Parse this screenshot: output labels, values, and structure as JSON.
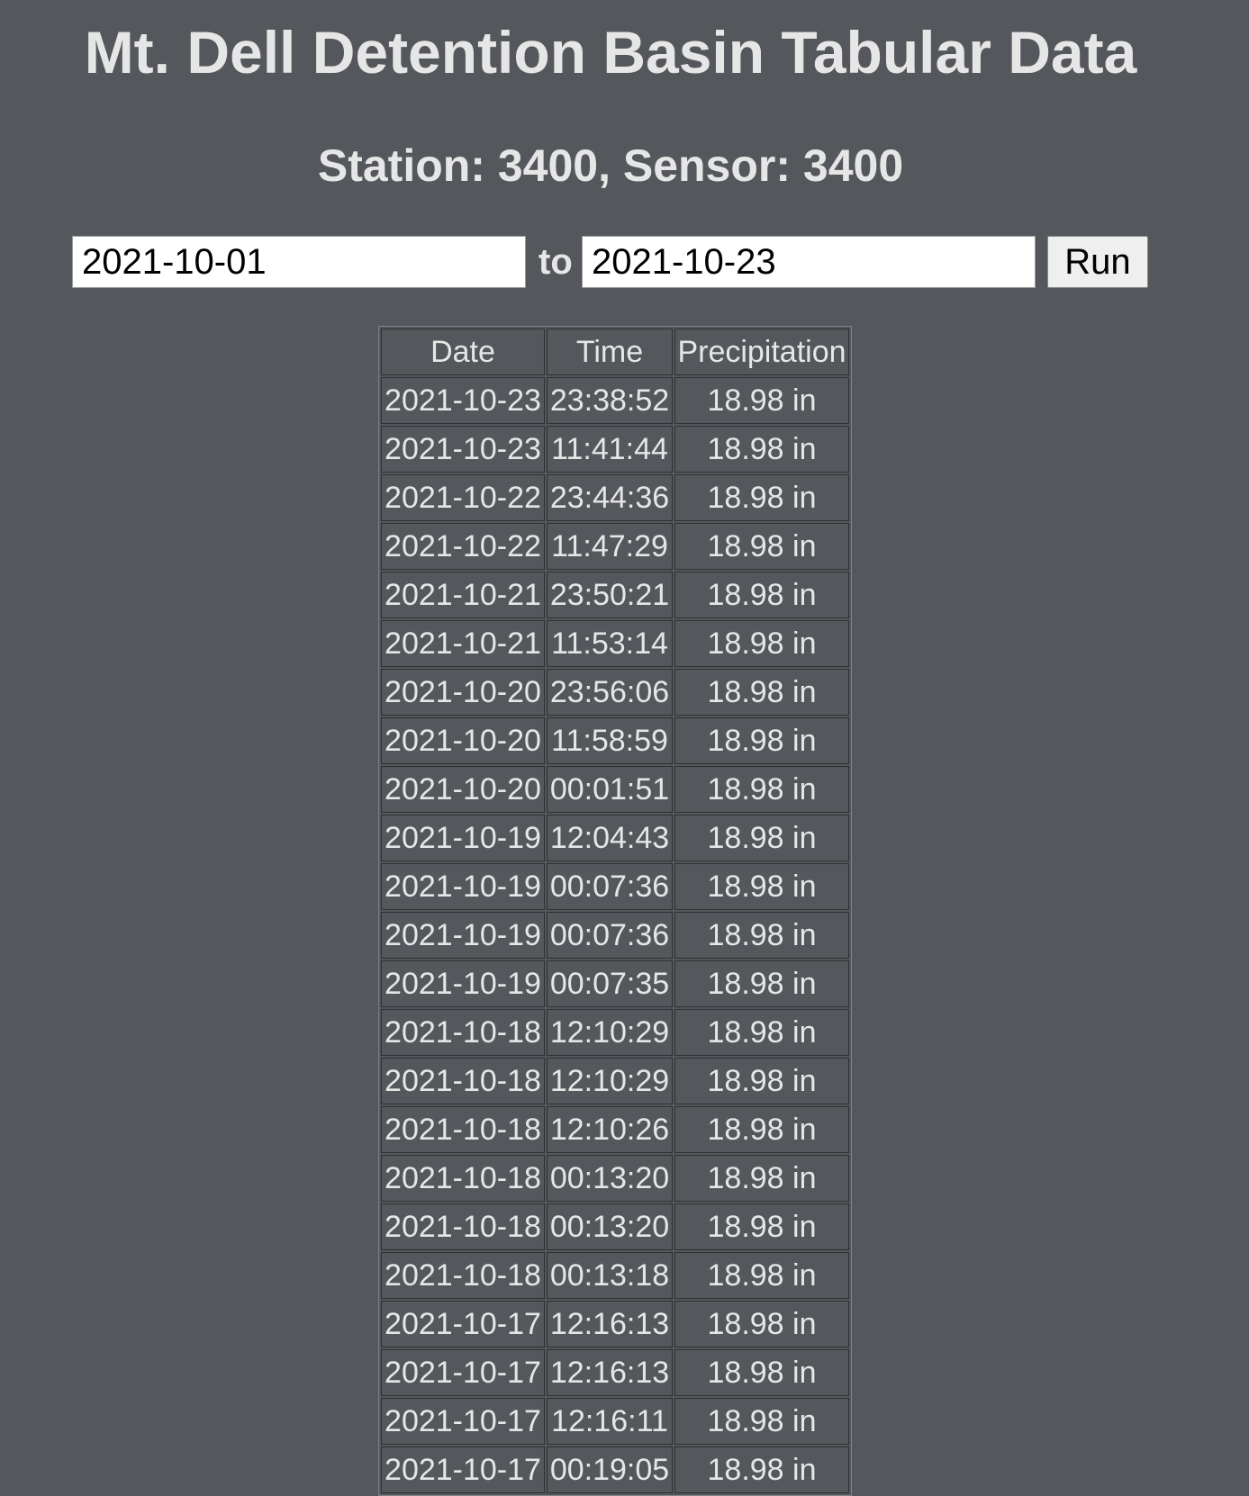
{
  "header": {
    "title": "Mt. Dell Detention Basin Tabular Data",
    "subtitle": "Station: 3400, Sensor: 3400"
  },
  "form": {
    "start_date": "2021-10-01",
    "to_label": "to",
    "end_date": "2021-10-23",
    "run_label": "Run"
  },
  "table": {
    "columns": [
      "Date",
      "Time",
      "Precipitation"
    ],
    "rows": [
      [
        "2021-10-23",
        "23:38:52",
        "18.98 in"
      ],
      [
        "2021-10-23",
        "11:41:44",
        "18.98 in"
      ],
      [
        "2021-10-22",
        "23:44:36",
        "18.98 in"
      ],
      [
        "2021-10-22",
        "11:47:29",
        "18.98 in"
      ],
      [
        "2021-10-21",
        "23:50:21",
        "18.98 in"
      ],
      [
        "2021-10-21",
        "11:53:14",
        "18.98 in"
      ],
      [
        "2021-10-20",
        "23:56:06",
        "18.98 in"
      ],
      [
        "2021-10-20",
        "11:58:59",
        "18.98 in"
      ],
      [
        "2021-10-20",
        "00:01:51",
        "18.98 in"
      ],
      [
        "2021-10-19",
        "12:04:43",
        "18.98 in"
      ],
      [
        "2021-10-19",
        "00:07:36",
        "18.98 in"
      ],
      [
        "2021-10-19",
        "00:07:36",
        "18.98 in"
      ],
      [
        "2021-10-19",
        "00:07:35",
        "18.98 in"
      ],
      [
        "2021-10-18",
        "12:10:29",
        "18.98 in"
      ],
      [
        "2021-10-18",
        "12:10:29",
        "18.98 in"
      ],
      [
        "2021-10-18",
        "12:10:26",
        "18.98 in"
      ],
      [
        "2021-10-18",
        "00:13:20",
        "18.98 in"
      ],
      [
        "2021-10-18",
        "00:13:20",
        "18.98 in"
      ],
      [
        "2021-10-18",
        "00:13:18",
        "18.98 in"
      ],
      [
        "2021-10-17",
        "12:16:13",
        "18.98 in"
      ],
      [
        "2021-10-17",
        "12:16:13",
        "18.98 in"
      ],
      [
        "2021-10-17",
        "12:16:11",
        "18.98 in"
      ],
      [
        "2021-10-17",
        "00:19:05",
        "18.98 in"
      ]
    ]
  },
  "colors": {
    "background": "#54575b",
    "text": "#e6e6e6",
    "input_background": "#ffffff",
    "button_background": "#efefef"
  }
}
